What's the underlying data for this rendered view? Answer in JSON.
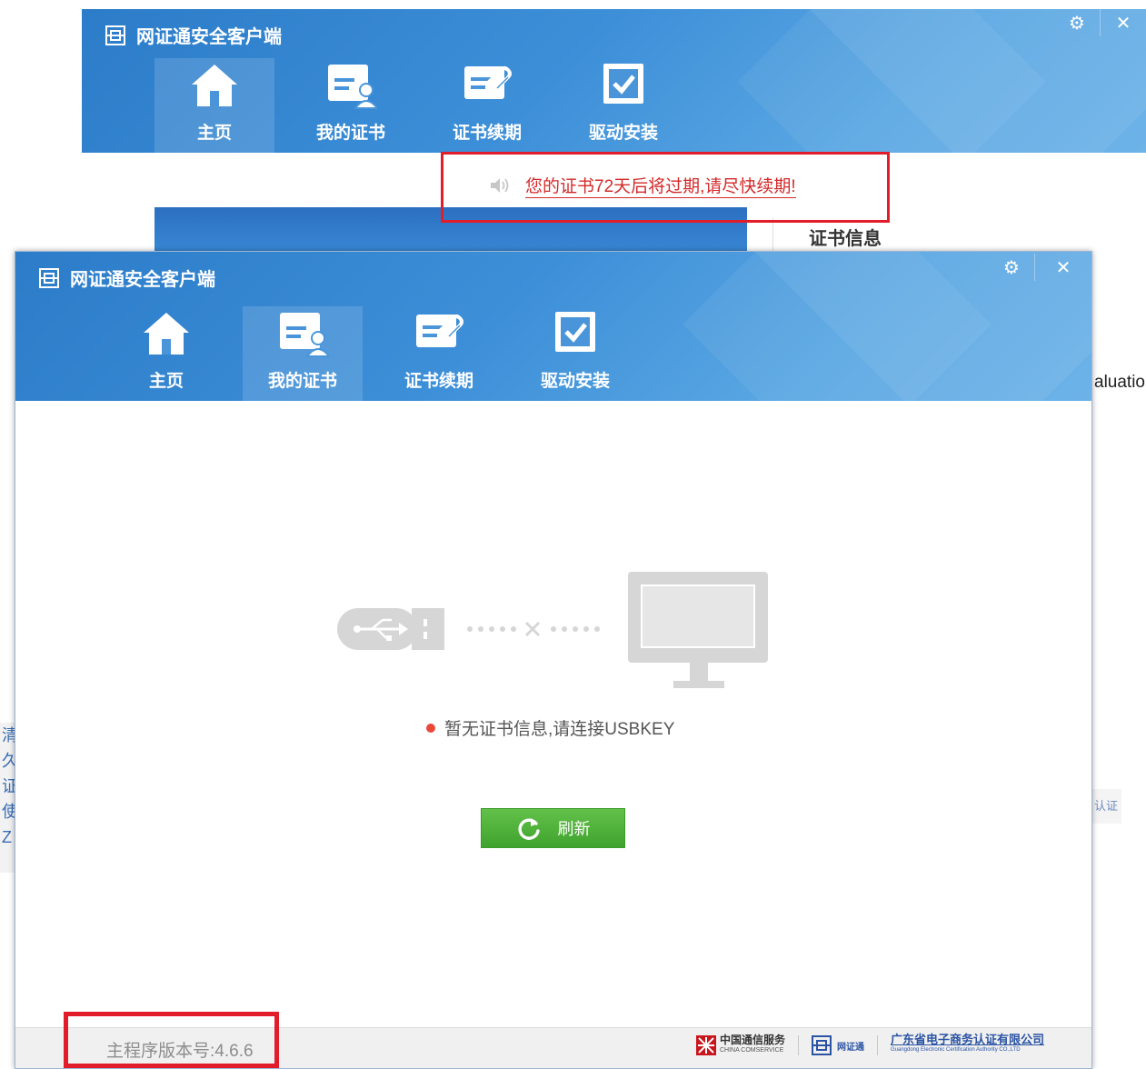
{
  "back_window": {
    "title": "网证通安全客户端",
    "nav": [
      "主页",
      "我的证书",
      "证书续期",
      "驱动安装"
    ],
    "notice_text": "您的证书72天后将过期,请尽快续期!",
    "cert_info_label": "证书信息"
  },
  "front_window": {
    "title": "网证通安全客户端",
    "nav": [
      "主页",
      "我的证书",
      "证书续期",
      "驱动安装"
    ],
    "active_tab": "我的证书",
    "status_text": "暂无证书信息,请连接USBKEY",
    "refresh_label": "刷新",
    "version_text": "主程序版本号:4.6.6",
    "partners": {
      "p1_name": "中国通信服务",
      "p1_sub": "CHINA COMSERVICE",
      "p2_name": "网证通",
      "p3_name": "广东省电子商务认证有限公司",
      "p3_sub": "Guangdong Electronic Certification Authority CO.,LTD"
    }
  },
  "background_fragments": {
    "right_text": "aluatio",
    "left_chars": [
      "清",
      "久",
      "证",
      "使",
      "Z"
    ],
    "right_small": "认证"
  },
  "colors": {
    "header_blue": "#3d8fd8",
    "highlight_red": "#e11d2c",
    "refresh_green": "#4fb43a",
    "status_dot": "#e84a3a"
  }
}
